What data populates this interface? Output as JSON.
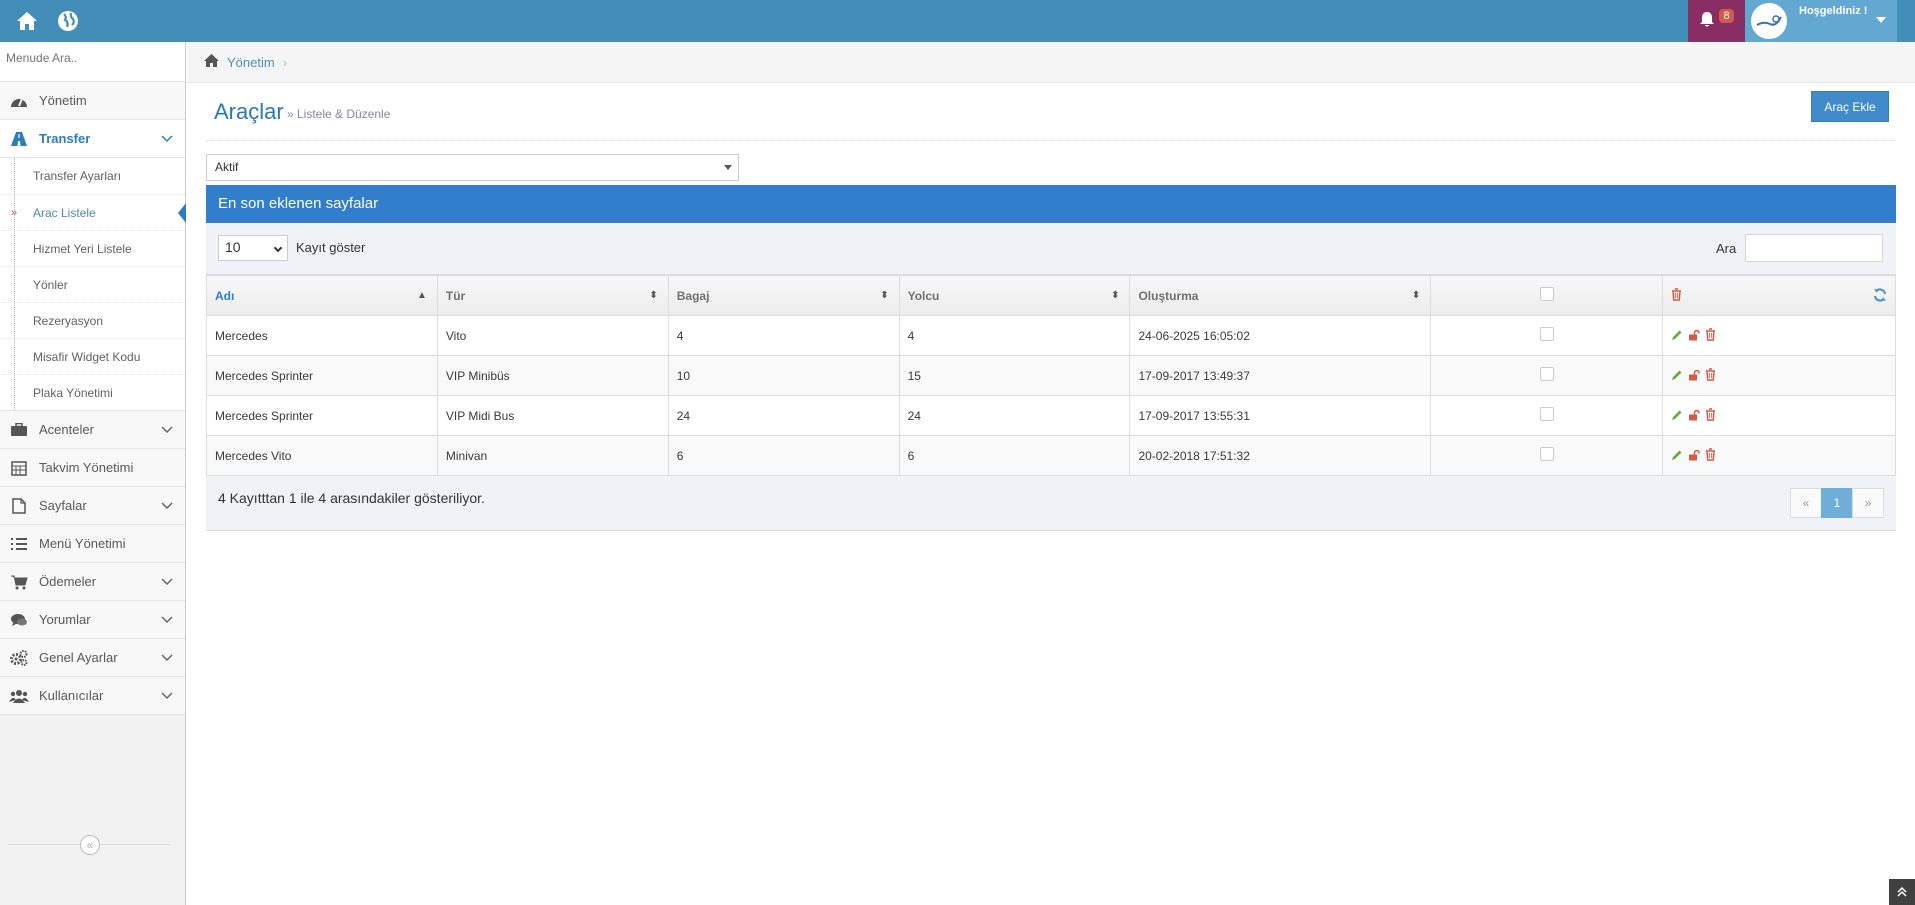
{
  "topbar": {
    "notif_count": "8",
    "greeting": "Hoşgeldiniz !"
  },
  "sidebar": {
    "search_placeholder": "Menude Ara..",
    "items": [
      {
        "label": "Yönetim",
        "icon": "dashboard-icon"
      },
      {
        "label": "Transfer",
        "icon": "road-icon"
      },
      {
        "label": "Acenteler",
        "icon": "briefcase-icon"
      },
      {
        "label": "Takvim Yönetimi",
        "icon": "calendar-icon"
      },
      {
        "label": "Sayfalar",
        "icon": "file-icon"
      },
      {
        "label": "Menü Yönetimi",
        "icon": "list-icon"
      },
      {
        "label": "Ödemeler",
        "icon": "cart-icon"
      },
      {
        "label": "Yorumlar",
        "icon": "comments-icon"
      },
      {
        "label": "Genel Ayarlar",
        "icon": "cogs-icon"
      },
      {
        "label": "Kullanıcılar",
        "icon": "users-icon"
      }
    ],
    "submenu": [
      {
        "label": "Transfer Ayarları"
      },
      {
        "label": "Arac Listele"
      },
      {
        "label": "Hizmet Yeri Listele"
      },
      {
        "label": "Yönler"
      },
      {
        "label": "Rezeryasyon"
      },
      {
        "label": "Misafir Widget Kodu"
      },
      {
        "label": "Plaka Yönetimi"
      }
    ]
  },
  "breadcrumb": {
    "home": "Yönetim"
  },
  "page": {
    "title": "Araçlar",
    "subtitle": "» Listele & Düzenle",
    "add_button": "Araç Ekle",
    "filter_value": "Aktif"
  },
  "panel": {
    "title": "En son eklenen sayfalar",
    "length_value": "10",
    "length_label": "Kayıt göster",
    "search_label": "Ara",
    "columns": [
      "Adı",
      "Tür",
      "Bagaj",
      "Yolcu",
      "Oluşturma"
    ],
    "rows": [
      {
        "name": "Mercedes",
        "type": "Vito",
        "bagaj": "4",
        "yolcu": "4",
        "date": "24-06-2025 16:05:02"
      },
      {
        "name": "Mercedes Sprinter",
        "type": "VIP Minibüs",
        "bagaj": "10",
        "yolcu": "15",
        "date": "17-09-2017 13:49:37"
      },
      {
        "name": "Mercedes Sprinter",
        "type": "VIP Midi Bus",
        "bagaj": "24",
        "yolcu": "24",
        "date": "17-09-2017 13:55:31"
      },
      {
        "name": "Mercedes Vito",
        "type": "Minivan",
        "bagaj": "6",
        "yolcu": "6",
        "date": "20-02-2018 17:51:32"
      }
    ],
    "info": "4 Kayıtttan 1 ile 4 arasındakiler gösteriliyor.",
    "pager": {
      "prev": "«",
      "current": "1",
      "next": "»"
    }
  }
}
